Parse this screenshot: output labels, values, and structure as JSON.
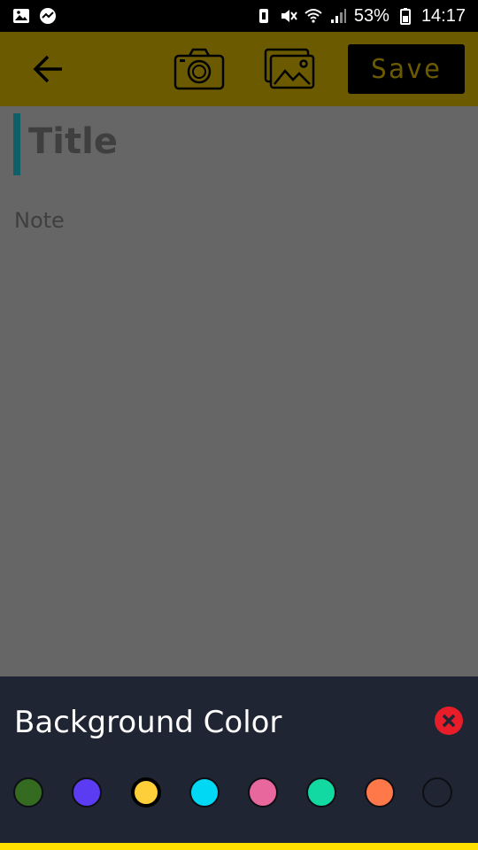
{
  "status_bar": {
    "battery": "53%",
    "time": "14:17"
  },
  "toolbar": {
    "save_label": "Save"
  },
  "editor": {
    "title_placeholder": "Title",
    "note_placeholder": "Note"
  },
  "bottom_sheet": {
    "title": "Background Color",
    "colors": [
      {
        "name": "green",
        "hex": "#356a21"
      },
      {
        "name": "indigo",
        "hex": "#5b3cf2"
      },
      {
        "name": "yellow",
        "hex": "#fecf39",
        "selected": true
      },
      {
        "name": "cyan",
        "hex": "#00d8f4"
      },
      {
        "name": "pink",
        "hex": "#e8679d"
      },
      {
        "name": "teal",
        "hex": "#12d9a1"
      },
      {
        "name": "orange",
        "hex": "#ff7849"
      },
      {
        "name": "navy",
        "hex": "#1f2532"
      }
    ]
  },
  "theme": {
    "toolbar_bg": "#6b5a00",
    "editor_bg": "#666666",
    "sheet_bg": "#1f2532",
    "accent_strip": "#ffe000"
  }
}
